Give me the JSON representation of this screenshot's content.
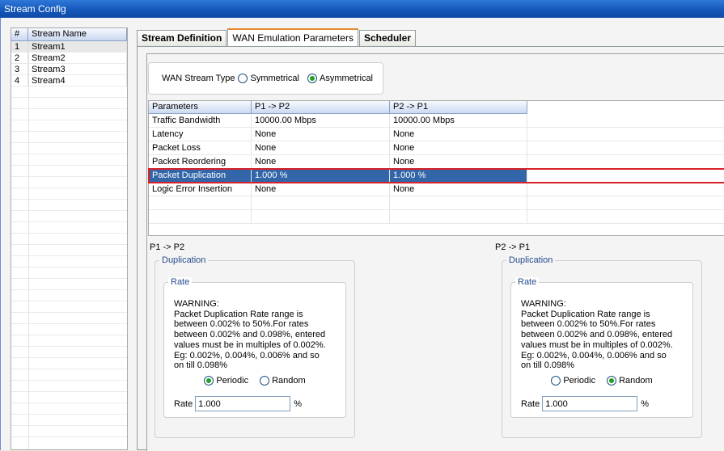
{
  "window": {
    "title": "Stream Config"
  },
  "stream_list": {
    "headers": {
      "index": "#",
      "name": "Stream Name"
    },
    "rows": [
      {
        "index": "1",
        "name": "Stream1"
      },
      {
        "index": "2",
        "name": "Stream2"
      },
      {
        "index": "3",
        "name": "Stream3"
      },
      {
        "index": "4",
        "name": "Stream4"
      }
    ]
  },
  "tabs": [
    {
      "label": "Stream Definition"
    },
    {
      "label": "WAN Emulation Parameters"
    },
    {
      "label": "Scheduler"
    }
  ],
  "wan_stream_type": {
    "label": "WAN Stream Type",
    "options": [
      "Symmetrical",
      "Asymmetrical"
    ],
    "selected": "Asymmetrical"
  },
  "param_table": {
    "headers": [
      "Parameters",
      "P1 -> P2",
      "P2 -> P1"
    ],
    "rows": [
      {
        "param": "Traffic Bandwidth",
        "p1p2": "10000.00 Mbps",
        "p2p1": "10000.00 Mbps"
      },
      {
        "param": "Latency",
        "p1p2": "None",
        "p2p1": "None"
      },
      {
        "param": "Packet Loss",
        "p1p2": "None",
        "p2p1": "None"
      },
      {
        "param": "Packet Reordering",
        "p1p2": "None",
        "p2p1": "None"
      },
      {
        "param": "Packet Duplication",
        "p1p2": "1.000 %",
        "p2p1": "1.000 %"
      },
      {
        "param": "Logic Error Insertion",
        "p1p2": "None",
        "p2p1": "None"
      }
    ],
    "selected_row": "Packet Duplication"
  },
  "left_panel": {
    "direction": "P1 -> P2",
    "group": "Duplication",
    "subgroup": "Rate",
    "warning_lines": [
      "WARNING:",
      "Packet Duplication Rate range is",
      "between 0.002% to 50%.For rates",
      "between 0.002% and 0.098%, entered",
      "values must be in multiples of 0.002%.",
      "Eg: 0.002%, 0.004%, 0.006% and so",
      "on till 0.098%"
    ],
    "modes": [
      "Periodic",
      "Random"
    ],
    "selected_mode": "Periodic",
    "rate_label": "Rate",
    "rate_value": "1.000",
    "rate_unit": "%"
  },
  "right_panel": {
    "direction": "P2 -> P1",
    "group": "Duplication",
    "subgroup": "Rate",
    "warning_lines": [
      "WARNING:",
      "Packet Duplication Rate range is",
      "between 0.002% to 50%.For rates",
      "between 0.002% and 0.098%, entered",
      "values must be in multiples of 0.002%.",
      "Eg: 0.002%, 0.004%, 0.006% and so",
      "on till 0.098%"
    ],
    "modes": [
      "Periodic",
      "Random"
    ],
    "selected_mode": "Random",
    "rate_label": "Rate",
    "rate_value": "1.000",
    "rate_unit": "%"
  },
  "colors": {
    "title_bar": "#1356b8",
    "selection": "#3266a8",
    "highlight_outline": "#d8222a",
    "active_tab_accent": "#e68b2c",
    "radio_dot": "#21a121"
  }
}
